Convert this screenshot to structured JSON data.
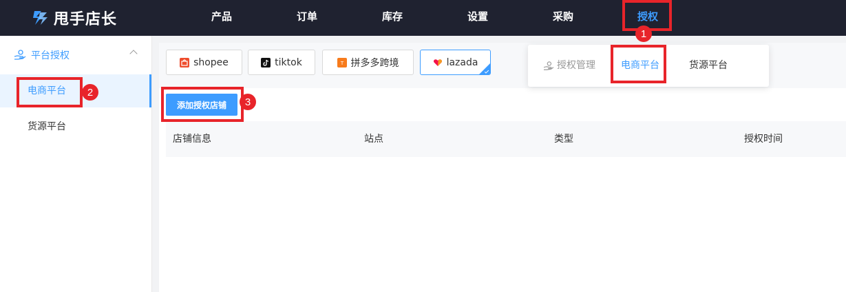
{
  "app": {
    "title": "甩手店长"
  },
  "nav": {
    "items": [
      {
        "label": "产品"
      },
      {
        "label": "订单"
      },
      {
        "label": "库存"
      },
      {
        "label": "设置"
      },
      {
        "label": "采购"
      },
      {
        "label": "授权",
        "active": true
      }
    ]
  },
  "sidebar": {
    "group_label": "平台授权",
    "items": [
      {
        "label": "电商平台",
        "active": true
      },
      {
        "label": "货源平台"
      }
    ]
  },
  "platform_tabs": [
    {
      "label": "shopee",
      "icon": "shopee-icon"
    },
    {
      "label": "tiktok",
      "icon": "tiktok-icon"
    },
    {
      "label": "拼多多跨境",
      "icon": "temu-icon"
    },
    {
      "label": "lazada",
      "icon": "lazada-icon",
      "selected": true
    }
  ],
  "toolbar": {
    "add_shop_label": "添加授权店铺"
  },
  "table": {
    "columns": [
      "店铺信息",
      "站点",
      "类型",
      "授权时间"
    ]
  },
  "dropdown": {
    "items": [
      {
        "label": "授权管理",
        "disabled": true
      },
      {
        "label": "电商平台",
        "active": true
      },
      {
        "label": "货源平台"
      }
    ]
  },
  "annotations": [
    "1",
    "2",
    "3"
  ],
  "colors": {
    "accent": "#3d9cff",
    "topbar": "#1f2230",
    "annotation": "#e8242a"
  }
}
